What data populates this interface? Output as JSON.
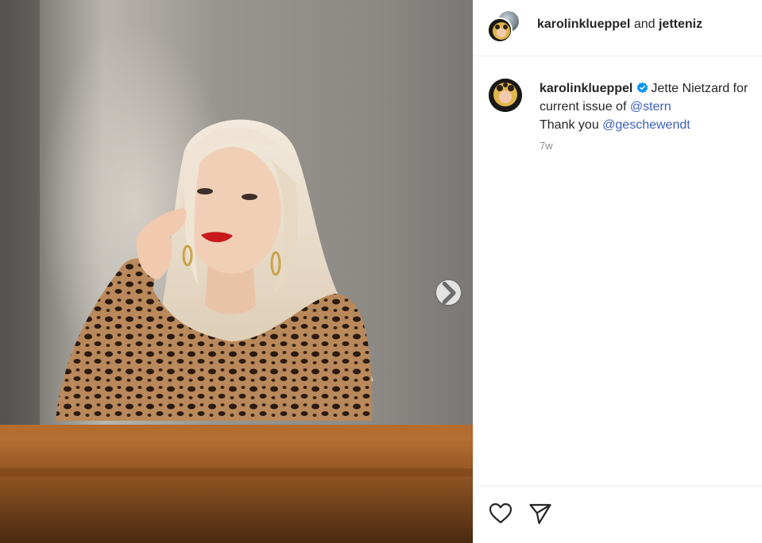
{
  "header": {
    "user1": "karolinklueppel",
    "joiner": "and",
    "user2": "jetteniz"
  },
  "caption": {
    "username": "karolinklueppel",
    "line1_text": "Jette Nietzard for",
    "line2_text": "current issue of ",
    "line2_mention": "@stern",
    "line3_text": "Thank you ",
    "line3_mention": "@geschewendt",
    "timestamp": "7w"
  },
  "icons": {
    "verified": "verified-badge-icon",
    "next": "chevron-right-icon",
    "like": "heart-icon",
    "share": "paper-plane-icon"
  },
  "colors": {
    "verified": "#0095f6",
    "mention": "#3b5fc0",
    "muted": "#8e8e8e",
    "text": "#262626"
  }
}
